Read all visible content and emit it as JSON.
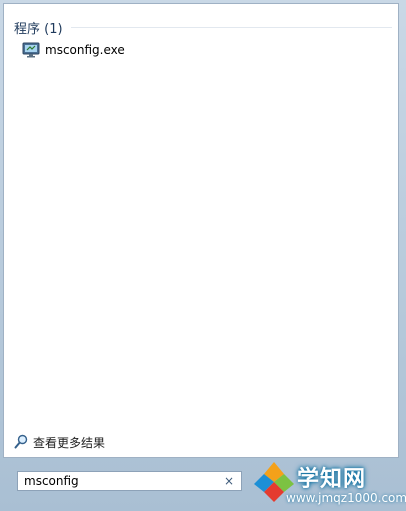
{
  "results": {
    "group_header": "程序 (1)",
    "items": [
      {
        "label": "msconfig.exe",
        "icon": "msconfig-app-icon"
      }
    ],
    "see_more_label": "查看更多结果",
    "see_more_icon": "magnifier-icon"
  },
  "search": {
    "value": "msconfig",
    "clear_symbol": "×"
  },
  "watermark": {
    "title": "学知网",
    "url": "www.jmqz1000.com"
  },
  "colors": {
    "header_text": "#1e395b",
    "menu_bg": "#b9cbdc",
    "logo_blue": "#0a6fa0"
  }
}
